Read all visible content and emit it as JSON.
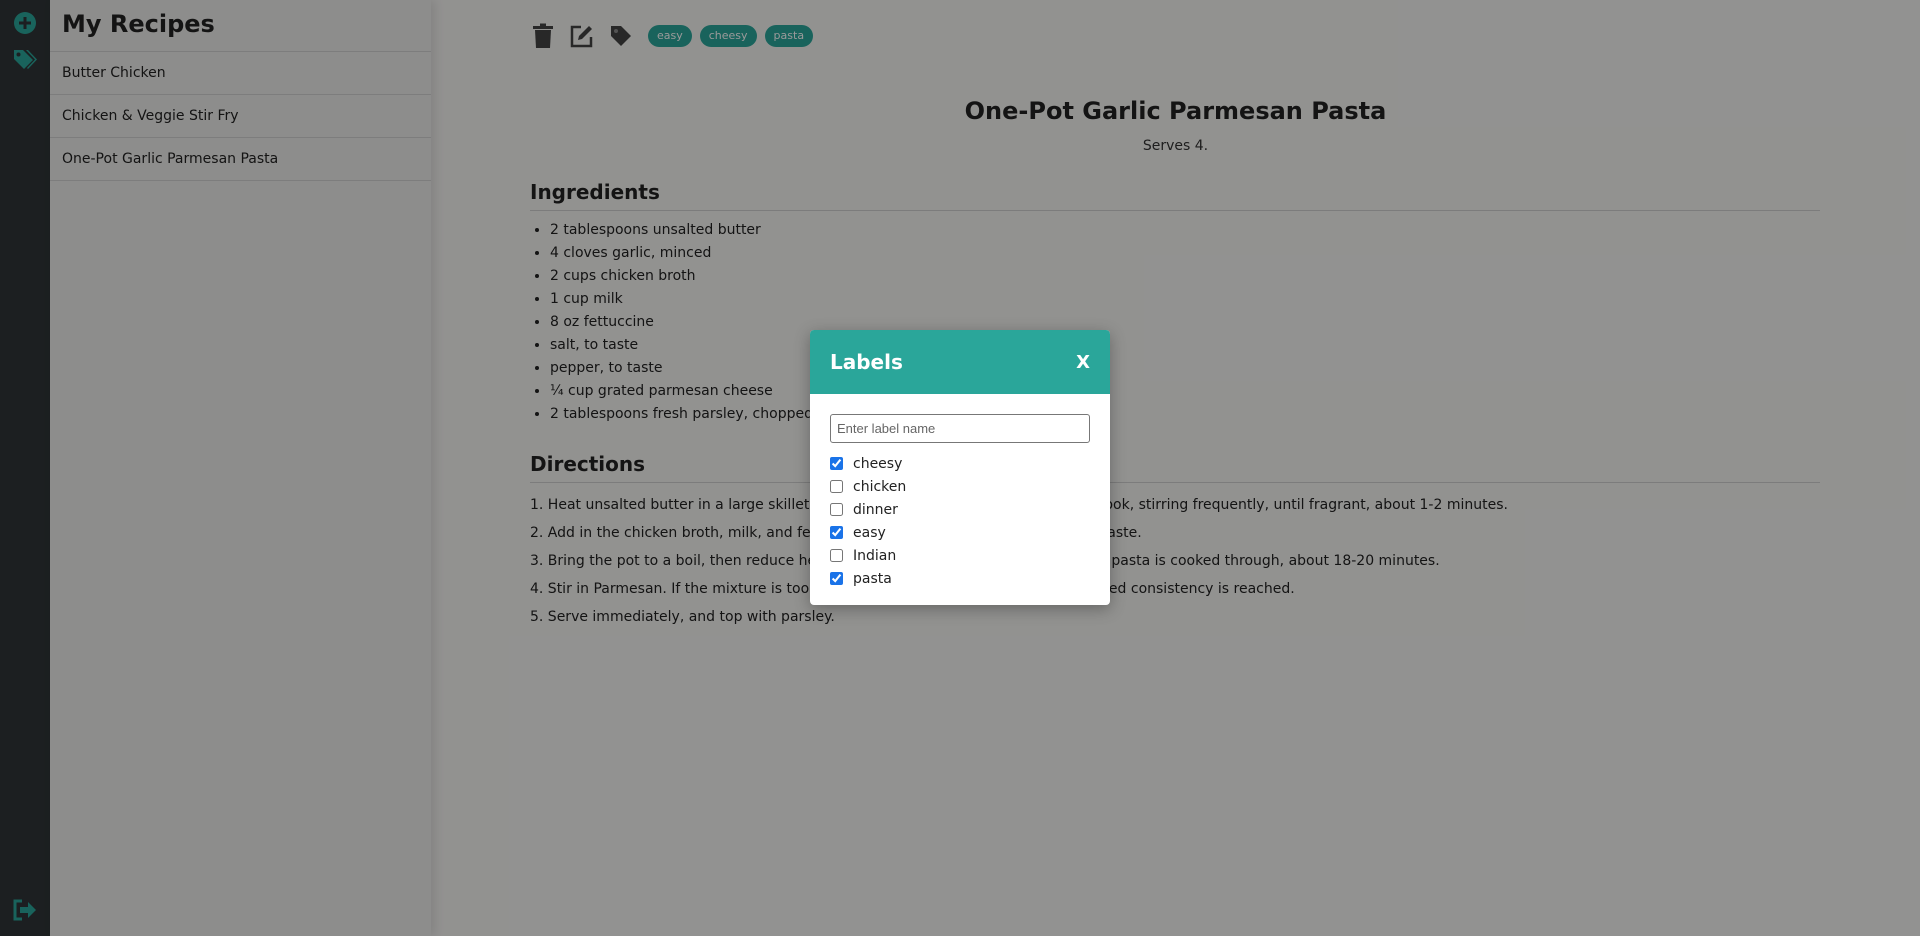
{
  "rail": {
    "icons": [
      "plus-circle-icon",
      "tags-icon",
      "sign-out-icon"
    ]
  },
  "sidebar": {
    "title": "My Recipes",
    "items": [
      {
        "label": "Butter Chicken"
      },
      {
        "label": "Chicken & Veggie Stir Fry"
      },
      {
        "label": "One-Pot Garlic Parmesan Pasta"
      }
    ]
  },
  "toolbar": {
    "icons": [
      "trash-icon",
      "edit-icon",
      "tag-icon"
    ],
    "tags": [
      "easy",
      "cheesy",
      "pasta"
    ]
  },
  "recipe": {
    "title": "One-Pot Garlic Parmesan Pasta",
    "serves": "Serves 4.",
    "ingredients_heading": "Ingredients",
    "ingredients": [
      "2 tablespoons unsalted butter",
      "4 cloves garlic, minced",
      "2 cups chicken broth",
      "1 cup milk",
      "8 oz fettuccine",
      "salt, to taste",
      "pepper, to taste",
      "¼ cup grated parmesan cheese",
      "2 tablespoons fresh parsley, chopped"
    ],
    "directions_heading": "Directions",
    "directions": [
      "1. Heat unsalted butter in a large skillet over medium high heat. Add garlic, and cook, stirring frequently, until fragrant, about 1-2 minutes.",
      "2. Add in the chicken broth, milk, and fettuccine; season with salt and pepper, to taste.",
      "3. Bring the pot to a boil, then reduce heat and simmer, stirring occasionally, until pasta is cooked through, about 18-20 minutes.",
      "4. Stir in Parmesan. If the mixture is too thick, add more milk as needed until desired consistency is reached.",
      "5. Serve immediately, and top with parsley."
    ]
  },
  "modal": {
    "title": "Labels",
    "close_label": "X",
    "input_placeholder": "Enter label name",
    "labels": [
      {
        "name": "cheesy",
        "checked": true
      },
      {
        "name": "chicken",
        "checked": false
      },
      {
        "name": "dinner",
        "checked": false
      },
      {
        "name": "easy",
        "checked": true
      },
      {
        "name": "Indian",
        "checked": false
      },
      {
        "name": "pasta",
        "checked": true
      }
    ]
  },
  "colors": {
    "accent": "#2aa69a",
    "rail": "#2f3537",
    "checkbox": "#1a73e8"
  }
}
